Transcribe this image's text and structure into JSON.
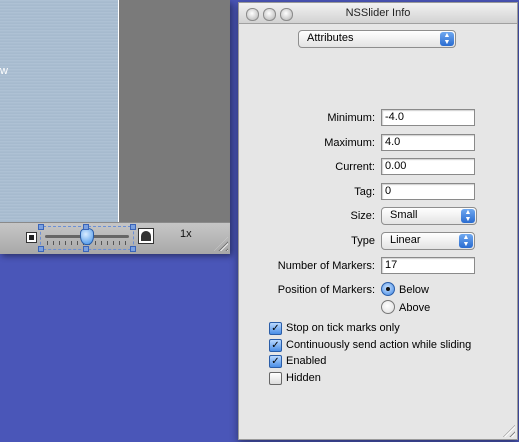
{
  "background_window": {
    "canvas_text": "w",
    "zoom_level": "1x",
    "zoom_slider_value": 0.5
  },
  "panel": {
    "title": "NSSlider Info",
    "section_popup": "Attributes",
    "labels": {
      "minimum": "Minimum:",
      "maximum": "Maximum:",
      "current": "Current:",
      "tag": "Tag:",
      "size": "Size:",
      "type": "Type",
      "number_of_markers": "Number of Markers:",
      "position_of_markers": "Position of Markers:"
    },
    "values": {
      "minimum": "-4.0",
      "maximum": "4.0",
      "current": "0.00",
      "tag": "0",
      "size": "Small",
      "type": "Linear",
      "number_of_markers": "17"
    },
    "marker_positions": [
      "Below",
      "Above"
    ],
    "marker_position_selected": "Below",
    "checkboxes": [
      {
        "label": "Stop on tick marks only",
        "checked": true
      },
      {
        "label": "Continuously send action while sliding",
        "checked": true
      },
      {
        "label": "Enabled",
        "checked": true
      },
      {
        "label": "Hidden",
        "checked": false
      }
    ]
  },
  "colors": {
    "desktop": "#4a56b8",
    "accent": "#3b85e4"
  }
}
